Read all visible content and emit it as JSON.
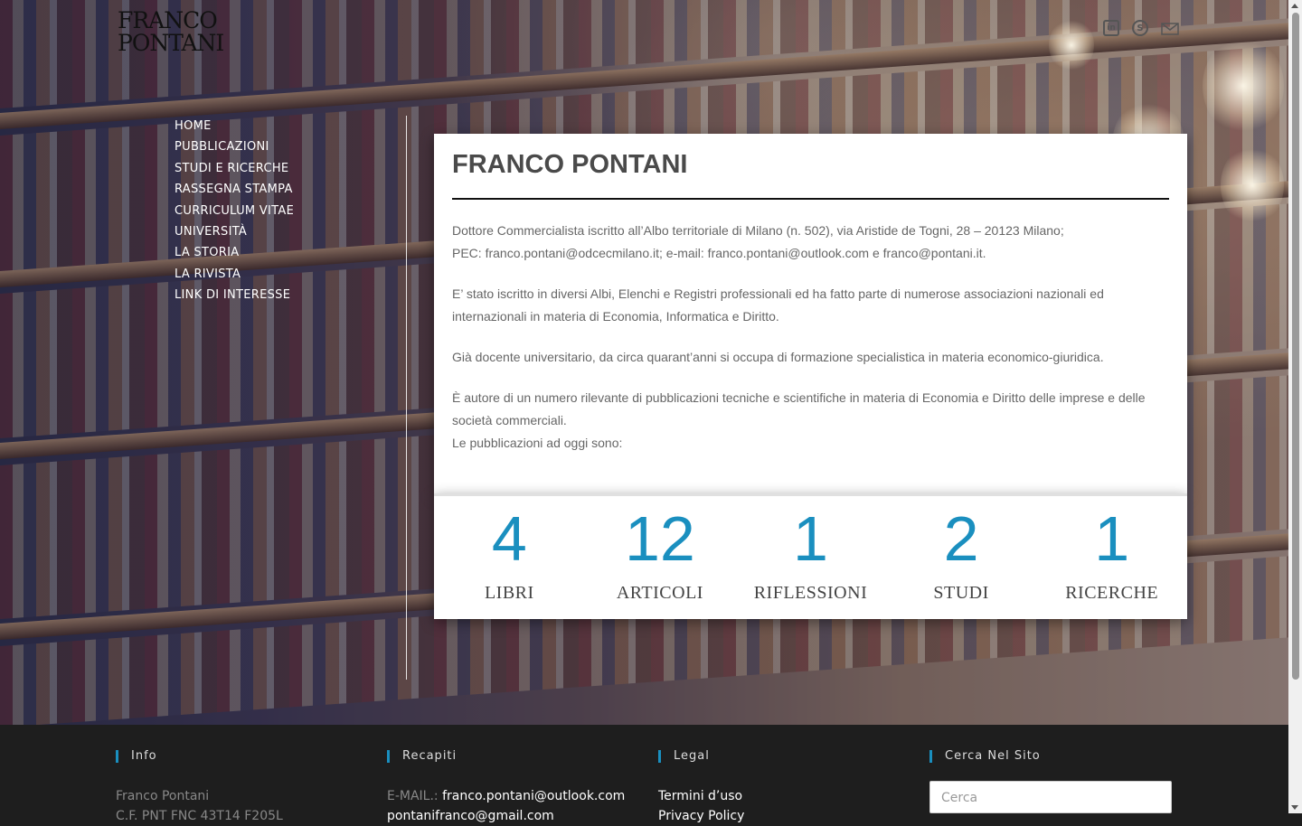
{
  "header": {
    "logo_line1": "FRANCO",
    "logo_line2": "PONTANI",
    "social_icons": [
      "linkedin-icon",
      "skype-icon",
      "mail-icon"
    ]
  },
  "nav": {
    "items": [
      {
        "label": "HOME"
      },
      {
        "label": "PUBBLICAZIONI"
      },
      {
        "label": "STUDI E RICERCHE"
      },
      {
        "label": "RASSEGNA STAMPA"
      },
      {
        "label": "CURRICULUM VITAE"
      },
      {
        "label": "UNIVERSITÀ"
      },
      {
        "label": "LA STORIA"
      },
      {
        "label": "LA RIVISTA"
      },
      {
        "label": "LINK DI INTERESSE"
      }
    ]
  },
  "main": {
    "title": "FRANCO PONTANI",
    "p1_line1": "Dottore Commercialista iscritto all’Albo territoriale di Milano (n. 502), via Aristide de Togni, 28 – 20123 Milano;",
    "p1_line2": "PEC: franco.pontani@odcecmilano.it; e-mail: franco.pontani@outlook.com e franco@pontani.it.",
    "p2": "E’ stato iscritto in diversi Albi, Elenchi e Registri professionali ed ha fatto parte di numerose associazioni nazionali ed internazionali in materia di Economia, Informatica e Diritto.",
    "p3": "Già docente universitario, da circa quarant’anni si occupa di formazione specialistica in materia economico-giuridica.",
    "p4": "È autore di un numero rilevante di pubblicazioni tecniche e scientifiche in materia di Economia e Diritto delle imprese e delle società commerciali.",
    "p5": "Le pubblicazioni ad oggi sono:"
  },
  "stats": [
    {
      "value": "4",
      "label": "LIBRI"
    },
    {
      "value": "12",
      "label": "ARTICOLI"
    },
    {
      "value": "1",
      "label": "RIFLESSIONI"
    },
    {
      "value": "2",
      "label": "STUDI"
    },
    {
      "value": "1",
      "label": "RICERCHE"
    }
  ],
  "footer": {
    "info": {
      "heading": "Info",
      "line1": "Franco Pontani",
      "line2": "C.F. PNT FNC 43T14 F205L"
    },
    "recapiti": {
      "heading": "Recapiti",
      "email_label": "E-MAIL.:",
      "email": "franco.pontani@outlook.com",
      "email2": "pontanifranco@gmail.com"
    },
    "legal": {
      "heading": "Legal",
      "link1": "Termini d’uso",
      "link2": "Privacy Policy"
    },
    "search": {
      "heading": "Cerca Nel Sito",
      "placeholder": "Cerca"
    }
  },
  "colors": {
    "accent": "#1a8fbf",
    "footer_bg": "#1e1e1e"
  }
}
